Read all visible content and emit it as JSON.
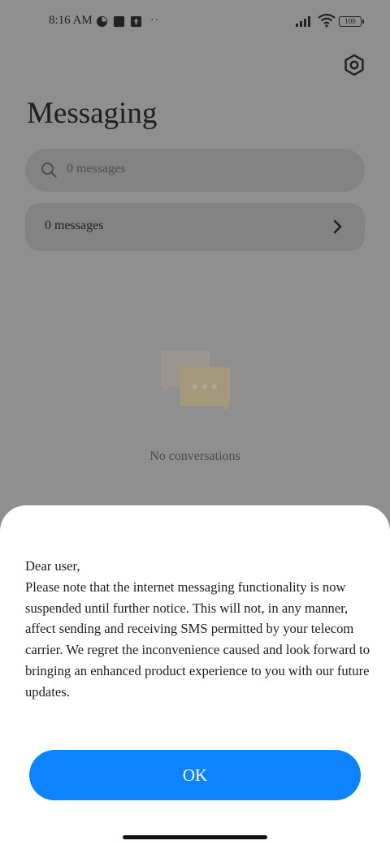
{
  "status_bar": {
    "time": "8:16 AM",
    "battery": "100",
    "icons": [
      "notification-app-icon",
      "notification-square-icon",
      "notification-upload-icon",
      "more-dots-icon",
      "signal-icon",
      "wifi-icon",
      "battery-icon"
    ],
    "more": "··"
  },
  "header": {
    "title": "Messaging",
    "settings_icon": "gear-icon"
  },
  "search": {
    "placeholder": "0 messages",
    "icon": "search-icon"
  },
  "messages_row": {
    "label": "0 messages",
    "icon": "chevron-right-icon"
  },
  "empty_state": {
    "text": "No conversations",
    "icon": "chat-bubbles-icon"
  },
  "dialog": {
    "lines": [
      "Dear user,",
      "Please note that the internet messaging functionality is now suspended until further notice. This will not, in any manner, affect sending and receiving SMS permitted by your telecom carrier. We regret the inconvenience caused and look forward to bringing an enhanced product experience to you with our future updates."
    ],
    "ok_label": "OK"
  },
  "colors": {
    "overlay_background": "#8f8f8f",
    "accent": "#0d84ff",
    "sheet": "#ffffff"
  }
}
